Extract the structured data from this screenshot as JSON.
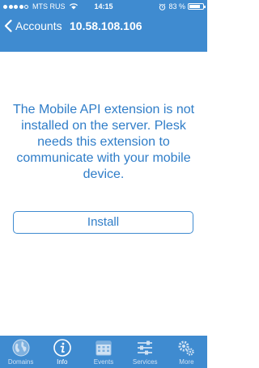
{
  "status_bar": {
    "carrier": "MTS RUS",
    "time": "14:15",
    "battery_percent_label": "83 %",
    "battery_level": 0.83
  },
  "nav": {
    "back_label": "Accounts",
    "title": "10.58.108.106"
  },
  "main": {
    "message": "The Mobile API extension is not installed on the server. Plesk needs this extension to communicate with your mobile device.",
    "install_label": "Install"
  },
  "tabs": [
    {
      "label": "Domains",
      "icon": "globe-icon",
      "active": false
    },
    {
      "label": "Info",
      "icon": "info-icon",
      "active": true
    },
    {
      "label": "Events",
      "icon": "calendar-icon",
      "active": false
    },
    {
      "label": "Services",
      "icon": "sliders-icon",
      "active": false
    },
    {
      "label": "More",
      "icon": "gears-icon",
      "active": false
    }
  ],
  "colors": {
    "brand": "#3f8bd0",
    "text_accent": "#2f7dc8"
  }
}
